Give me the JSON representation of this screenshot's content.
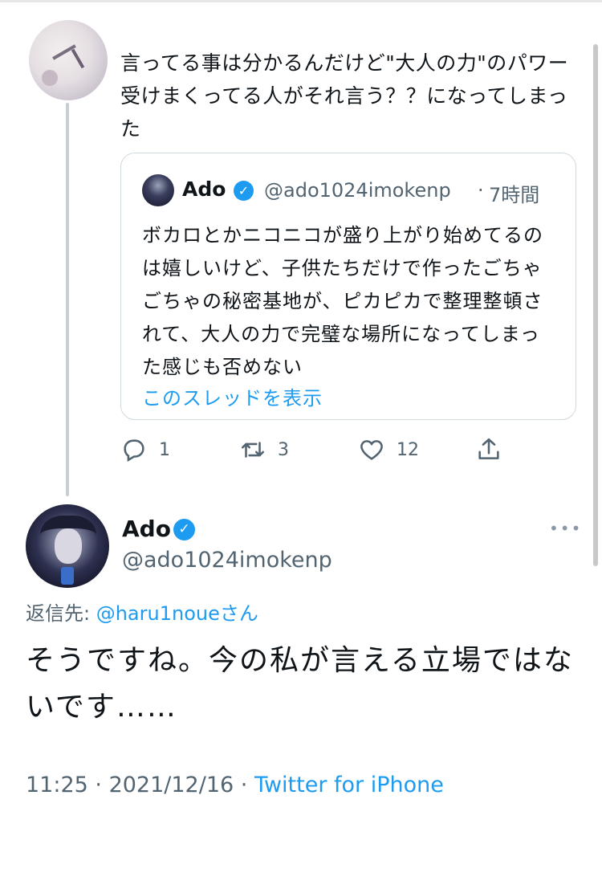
{
  "previous_tweet": {
    "text": "言ってる事は分かるんだけど\"大人の力\"のパワー受けまくってる人がそれ言う？？になってしまった",
    "quote": {
      "name": "Ado",
      "handle": "@ado1024imokenp",
      "separator": "·",
      "time": "7時間",
      "text": "ボカロとかニコニコが盛り上がり始めてるのは嬉しいけど、子供たちだけで作ったごちゃごちゃの秘密基地が、ピカピカで整理整頓されて、大人の力で完璧な場所になってしまった感じも否めない",
      "show_thread": "このスレッドを表示"
    },
    "actions": {
      "reply_icon": "reply-icon",
      "reply_count": "1",
      "retweet_icon": "retweet-icon",
      "retweet_count": "3",
      "like_icon": "heart-icon",
      "like_count": "12",
      "share_icon": "share-icon"
    }
  },
  "main_tweet": {
    "name": "Ado",
    "handle": "@ado1024imokenp",
    "verified_icon": "verified-badge-icon",
    "more_icon": "more-icon",
    "reply_label": "返信先: ",
    "reply_mention": "@haru1noue",
    "reply_suffix": "さん",
    "text": "そうですね。今の私が言える立場ではないです……",
    "time": "11:25",
    "sep1": " · ",
    "date": "2021/12/16",
    "sep2": " · ",
    "client": "Twitter for iPhone"
  },
  "colors": {
    "accent": "#1d9bf0",
    "secondary_text": "#536471",
    "border": "#cfd9de"
  }
}
